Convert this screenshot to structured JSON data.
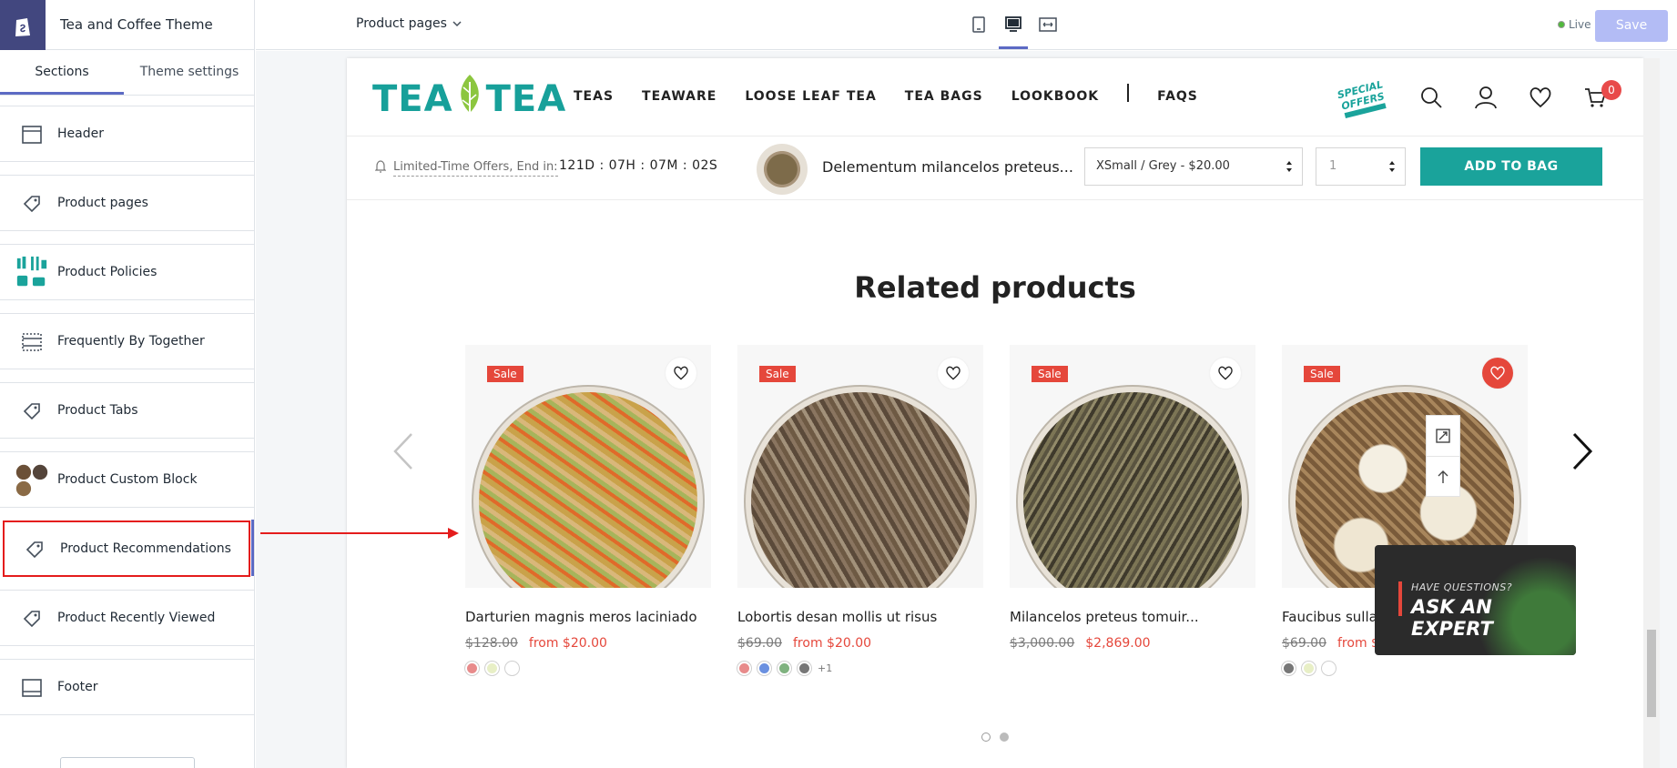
{
  "editor": {
    "theme_name": "Tea and Coffee Theme",
    "tabs": [
      {
        "label": "Sections"
      },
      {
        "label": "Theme settings"
      }
    ],
    "sections": [
      {
        "label": "Header",
        "icon": "header-layout-icon"
      },
      {
        "label": "Product pages",
        "icon": "tag-icon"
      },
      {
        "label": "Product Policies",
        "icon": "policies-illustration-icon"
      },
      {
        "label": "Frequently By Together",
        "icon": "section-layout-icon"
      },
      {
        "label": "Product Tabs",
        "icon": "tag-icon"
      },
      {
        "label": "Product Custom Block",
        "icon": "custom-block-thumbnails-icon"
      },
      {
        "label": "Product Recommendations",
        "icon": "tag-icon"
      },
      {
        "label": "Product Recently Viewed",
        "icon": "tag-icon"
      },
      {
        "label": "Footer",
        "icon": "footer-layout-icon"
      }
    ]
  },
  "topbar": {
    "page_select": "Product pages",
    "status": "Live",
    "save_label": "Save",
    "accent": "#5c6ac4"
  },
  "store": {
    "logo_left": "TEA",
    "logo_right": "TEA",
    "nav": [
      "TEAS",
      "TEAWARE",
      "LOOSE LEAF TEA",
      "TEA BAGS",
      "LOOKBOOK",
      "FAQS"
    ],
    "special_offers": "SPECIAL OFFERS",
    "cart_count": "0",
    "brand_color": "#1aa39b"
  },
  "sticky_bar": {
    "offer_text": "Limited-Time Offers, End in:",
    "countdown": "121D : 07H : 07M : 02S",
    "product_name": "Delementum milancelos preteus...",
    "variant": "XSmall / Grey - $20.00",
    "quantity": "1",
    "add_to_bag": "ADD TO BAG"
  },
  "related": {
    "title": "Related products",
    "products": [
      {
        "name": "Darturien magnis meros laciniado",
        "old_price": "$128.00",
        "new_price": "from $20.00",
        "sale": "Sale",
        "wishlisted": false,
        "swatches": [
          "#e88b8b",
          "#e8efc6",
          "#ffffff"
        ],
        "more": ""
      },
      {
        "name": "Lobortis desan mollis ut risus",
        "old_price": "$69.00",
        "new_price": "from $20.00",
        "sale": "Sale",
        "wishlisted": false,
        "swatches": [
          "#e88b8b",
          "#6a90e0",
          "#7fb27f",
          "#777777"
        ],
        "more": "+1"
      },
      {
        "name": "Milancelos preteus tomuir...",
        "old_price": "$3,000.00",
        "new_price": "$2,869.00",
        "sale": "Sale",
        "wishlisted": false,
        "swatches": [],
        "more": ""
      },
      {
        "name": "Faucibus sulla",
        "old_price": "$69.00",
        "new_price": "from $",
        "sale": "Sale",
        "wishlisted": true,
        "swatches": [
          "#777777",
          "#e8efc6",
          "#ffffff"
        ],
        "more": ""
      }
    ],
    "expert_question": "HAVE QUESTIONS?",
    "expert_cta": "ASK AN EXPERT",
    "sale_color": "#e5473b"
  }
}
